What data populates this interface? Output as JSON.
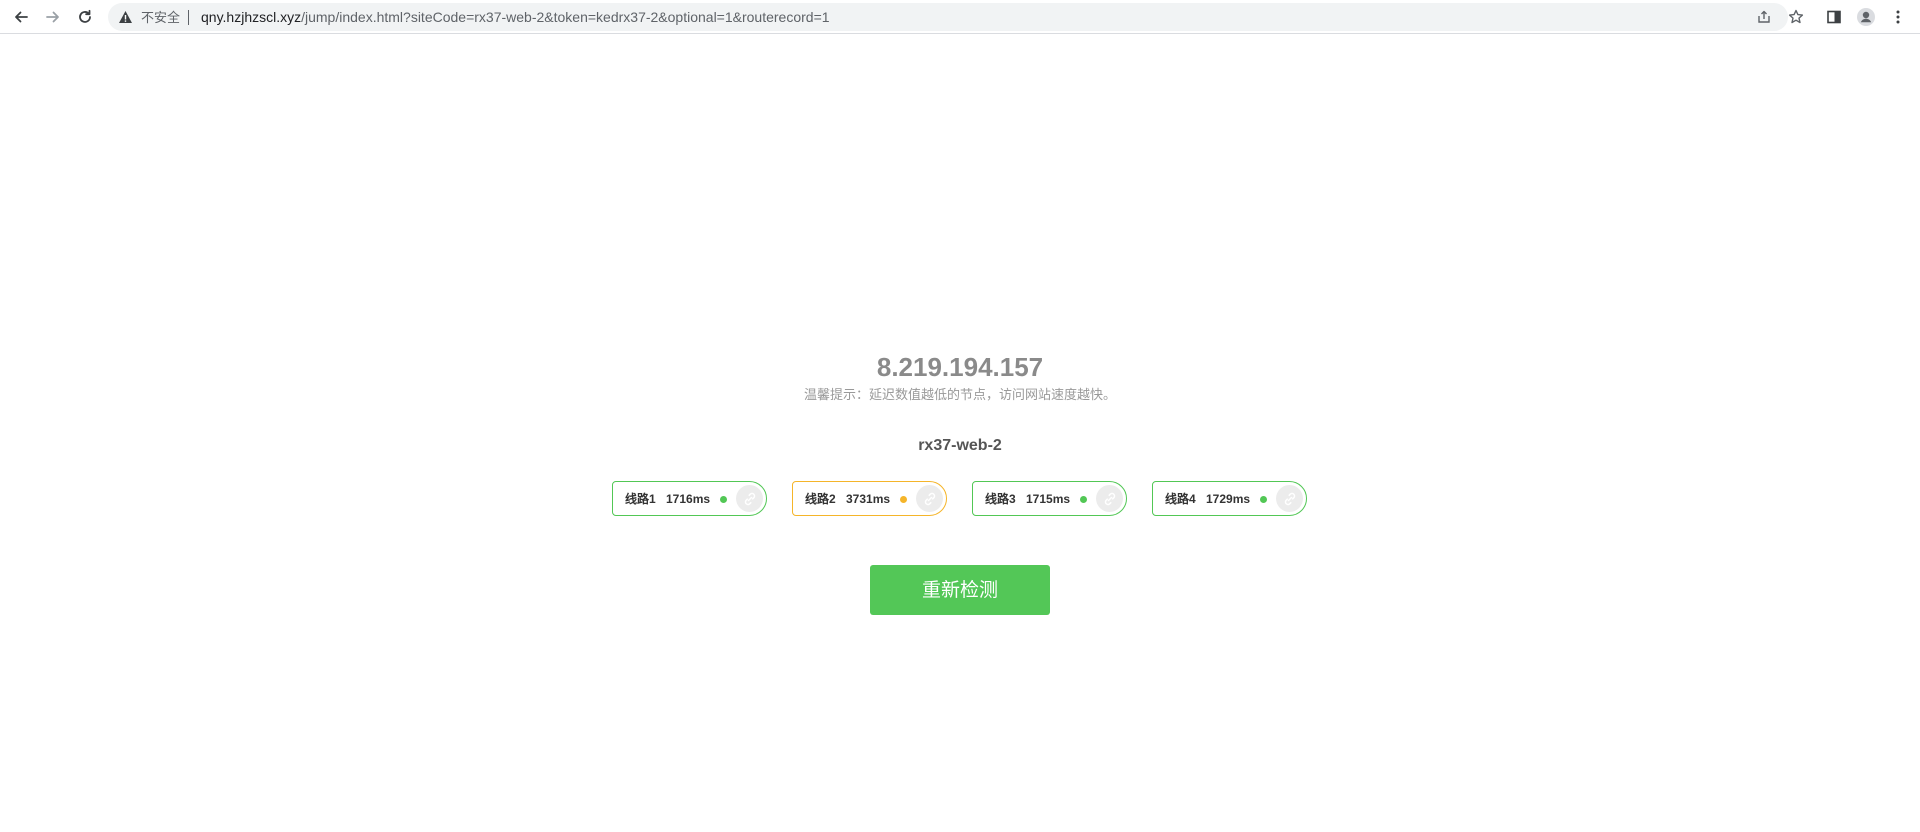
{
  "browser": {
    "security_label": "不安全",
    "url_host": "qny.hzjhzscl.xyz",
    "url_rest": "/jump/index.html?siteCode=rx37-web-2&token=kedrx37-2&optional=1&routerecord=1"
  },
  "page": {
    "ip": "8.219.194.157",
    "tip": "温馨提示：延迟数值越低的节点，访问网站速度越快。",
    "site_code": "rx37-web-2",
    "routes": [
      {
        "name": "线路1",
        "latency": "1716ms",
        "status_color": "#52c755"
      },
      {
        "name": "线路2",
        "latency": "3731ms",
        "status_color": "#f5b52a"
      },
      {
        "name": "线路3",
        "latency": "1715ms",
        "status_color": "#52c755"
      },
      {
        "name": "线路4",
        "latency": "1729ms",
        "status_color": "#52c755"
      }
    ],
    "recheck_label": "重新检测"
  },
  "colors": {
    "accent_green": "#53c757",
    "warn_yellow": "#f5b52a"
  }
}
